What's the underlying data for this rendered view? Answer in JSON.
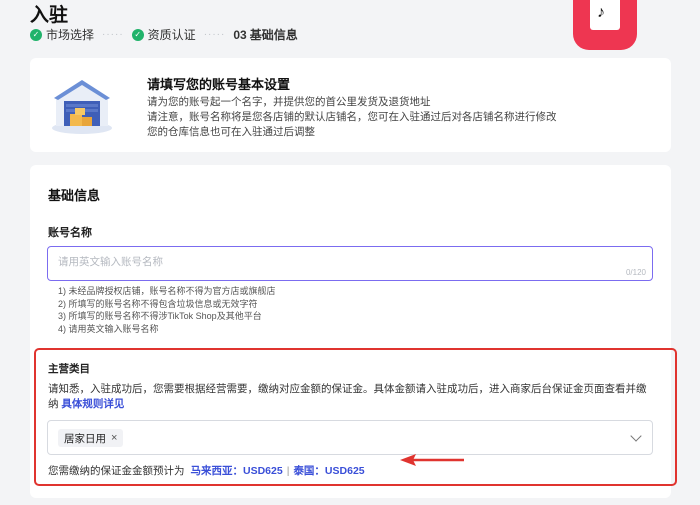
{
  "page": {
    "title": "入驻"
  },
  "steps": [
    {
      "label": "市场选择",
      "status": "done"
    },
    {
      "label": "资质认证",
      "status": "done"
    },
    {
      "number": "03",
      "label": "基础信息",
      "status": "current"
    }
  ],
  "intro": {
    "title": "请填写您的账号基本设置",
    "lines": [
      "请为您的账号起一个名字，并提供您的首公里发货及退货地址",
      "请注意，账号名称将是您各店铺的默认店铺名，您可在入驻通过后对各店铺名称进行修改",
      "您的仓库信息也可在入驻通过后调整"
    ]
  },
  "basic_info": {
    "section_title": "基础信息",
    "account_name": {
      "label": "账号名称",
      "placeholder": "请用英文输入账号名称",
      "value": "",
      "counter": "0/120"
    },
    "rules": [
      "1) 未经品牌授权店铺，账号名称不得为官方店或旗舰店",
      "2) 所填写的账号名称不得包含垃圾信息或无效字符",
      "3) 所填写的账号名称不得涉TikTok Shop及其他平台",
      "4) 请用英文输入账号名称"
    ],
    "main_category": {
      "label": "主营类目",
      "description": "请知悉，入驻成功后，您需要根据经营需要，缴纳对应金额的保证金。具体金额请入驻成功后，进入商家后台保证金页面查看并缴纳",
      "link": "具体规则详见",
      "selected_tag": "居家日用",
      "deposit_prefix": "您需缴纳的保证金金额预计为",
      "deposit_my": "马来西亚：USD625",
      "deposit_sep": "|",
      "deposit_th": "泰国：USD625"
    }
  },
  "colors": {
    "brand": "#ee3651",
    "success": "#21b36b",
    "link": "#3a4fd8",
    "highlight_box": "#e0342f",
    "input_focus": "#7b6cf0"
  },
  "icons": {
    "step_done": "check-circle-icon",
    "app": "tiktok-shop-bag-icon",
    "intro": "warehouse-illustration",
    "tag_remove": "close-icon",
    "select": "chevron-down-icon",
    "annotation": "red-arrow"
  }
}
